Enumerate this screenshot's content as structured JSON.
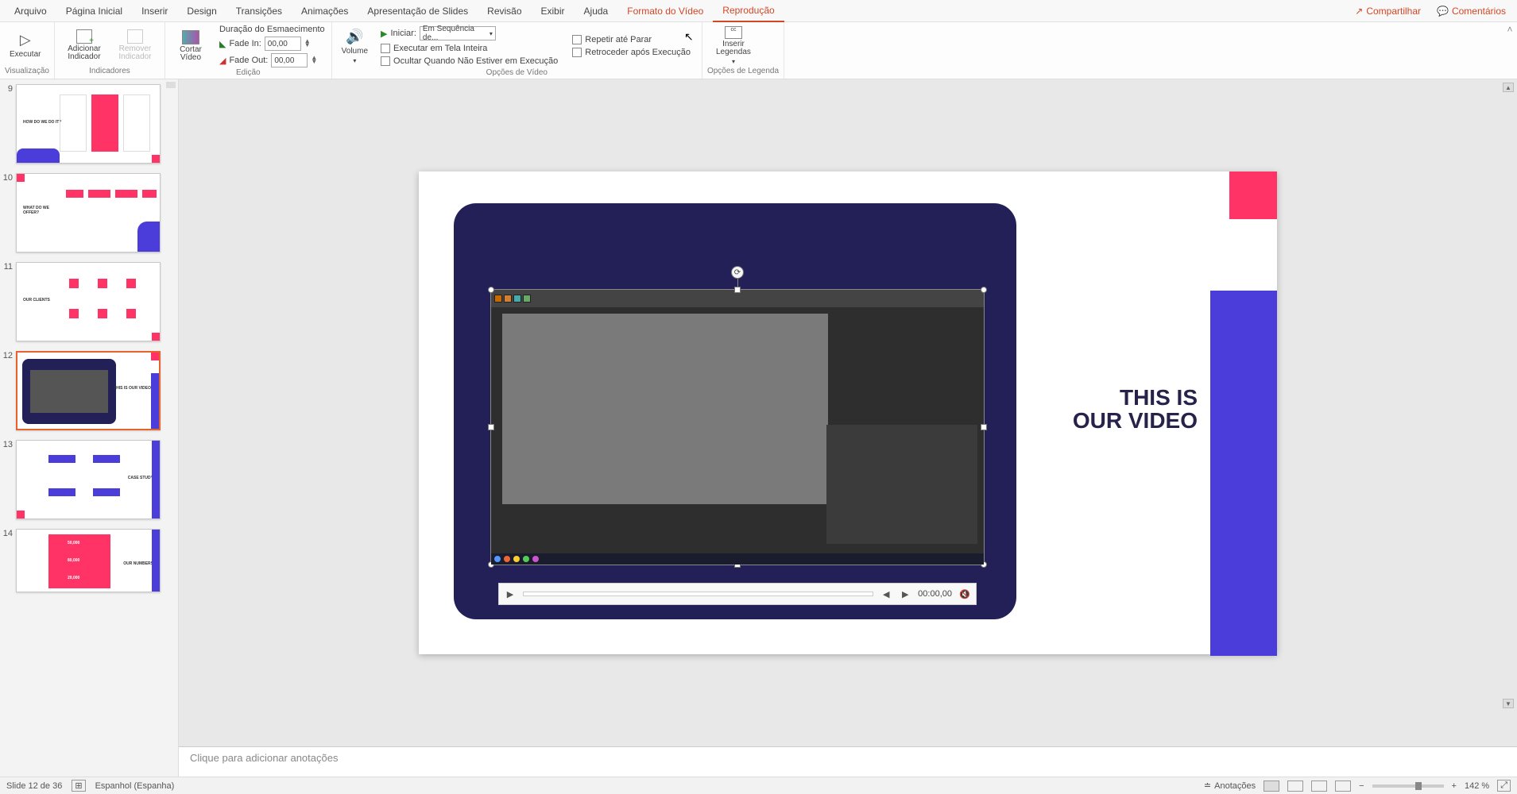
{
  "menu": {
    "items": [
      "Arquivo",
      "Página Inicial",
      "Inserir",
      "Design",
      "Transições",
      "Animações",
      "Apresentação de Slides",
      "Revisão",
      "Exibir",
      "Ajuda",
      "Formato do Vídeo",
      "Reprodução"
    ],
    "share": "Compartilhar",
    "comments": "Comentários"
  },
  "ribbon": {
    "preview_group": "Visualização",
    "play_btn": "Executar",
    "bookmarks_group": "Indicadores",
    "add_bookmark": "Adicionar Indicador",
    "remove_bookmark": "Remover Indicador",
    "editing_group": "Edição",
    "trim_video": "Cortar Vídeo",
    "fade_title": "Duração do Esmaecimento",
    "fade_in": "Fade In:",
    "fade_in_val": "00,00",
    "fade_out": "Fade Out:",
    "fade_out_val": "00,00",
    "video_opts_group": "Opções de Vídeo",
    "volume": "Volume",
    "start_label": "Iniciar:",
    "start_combo": "Em Sequência de...",
    "fullscreen": "Executar em Tela Inteira",
    "hide_not_playing": "Ocultar Quando Não Estiver em Execução",
    "loop": "Repetir até Parar",
    "rewind": "Retroceder após Execução",
    "caption_group": "Opções de Legenda",
    "insert_captions": "Inserir Legendas"
  },
  "thumbs": {
    "nums": [
      "9",
      "10",
      "11",
      "12",
      "13",
      "14"
    ],
    "labels": {
      "t9a": "HOW DO WE DO IT?",
      "t10a": "WHAT DO WE OFFER?",
      "t11a": "OUR CLIENTS",
      "t12a": "THIS IS OUR VIDEO",
      "t13a": "CASE STUDY",
      "t14a": "OUR NUMBERS",
      "n1": "50,000",
      "n2": "80,000",
      "n3": "20,000"
    }
  },
  "slide": {
    "title_line1": "THIS IS",
    "title_line2": "OUR VIDEO",
    "video_time": "00:00,00"
  },
  "notes": {
    "placeholder": "Clique para adicionar anotações"
  },
  "status": {
    "slide_counter": "Slide 12 de 36",
    "language": "Espanhol (Espanha)",
    "notes_btn": "Anotações",
    "zoom": "142 %"
  }
}
